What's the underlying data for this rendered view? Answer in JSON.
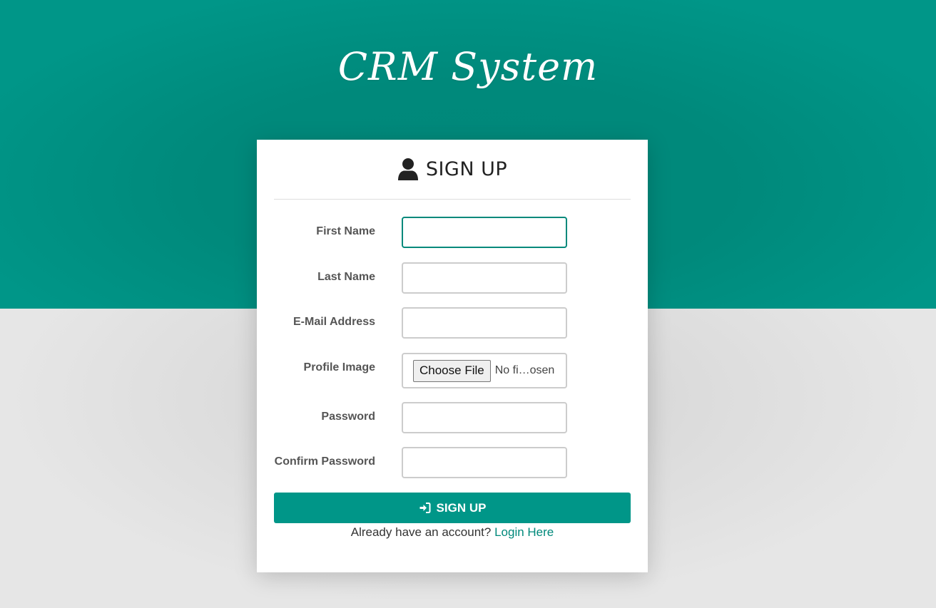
{
  "brand": {
    "title": "CRM System"
  },
  "form": {
    "heading": "SIGN UP",
    "fields": {
      "first_name": {
        "label": "First Name",
        "value": "",
        "placeholder": ""
      },
      "last_name": {
        "label": "Last Name",
        "value": "",
        "placeholder": ""
      },
      "email": {
        "label": "E-Mail Address",
        "value": "",
        "placeholder": ""
      },
      "profile_image": {
        "label": "Profile Image",
        "button_label": "Choose File",
        "status": "No fi…osen"
      },
      "password": {
        "label": "Password",
        "value": "",
        "placeholder": ""
      },
      "confirm_password": {
        "label": "Confirm Password",
        "value": "",
        "placeholder": ""
      }
    },
    "submit_label": "SIGN UP",
    "footer_text": "Already have an account?",
    "login_link": "Login Here"
  },
  "icons": {
    "header": "user-icon",
    "submit": "sign-in-icon"
  },
  "colors": {
    "primary": "#009688",
    "link": "#00897b",
    "background": "#e6e6e6"
  }
}
